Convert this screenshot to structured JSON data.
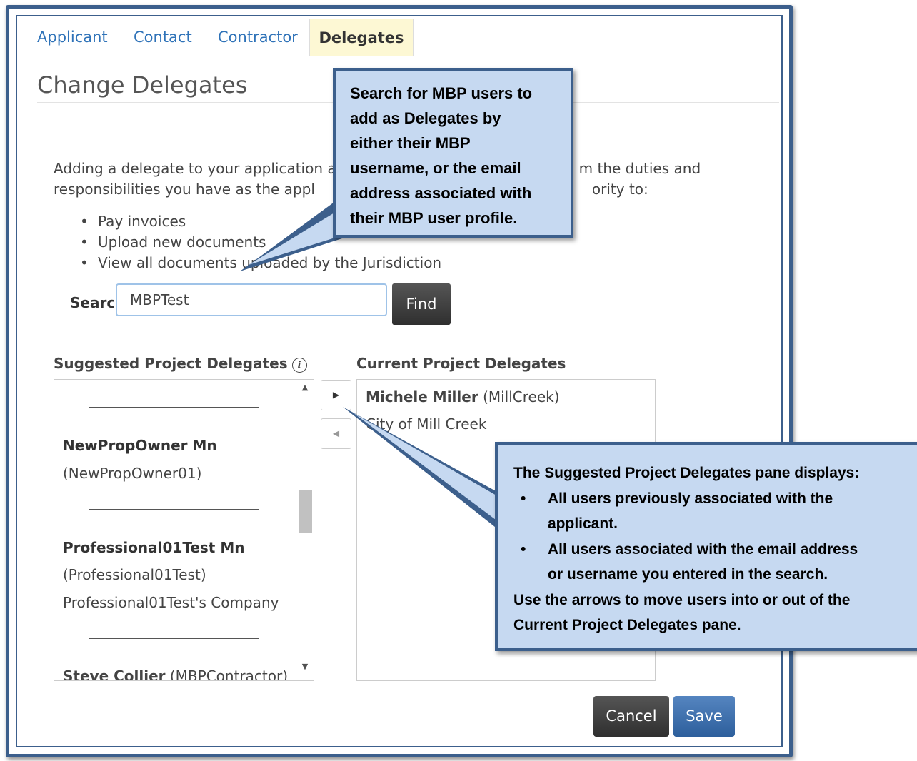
{
  "tabs": [
    {
      "label": "Applicant",
      "active": false
    },
    {
      "label": "Contact",
      "active": false
    },
    {
      "label": "Contractor",
      "active": false
    },
    {
      "label": "Delegates",
      "active": true
    }
  ],
  "page_title": "Change Delegates",
  "intro": {
    "line1_start": "Adding a delegate to your application a",
    "line1_end": "m the duties and",
    "line2_start": "responsibilities you have as the appl",
    "line2_end": "ority to:"
  },
  "bullets": [
    "Pay invoices",
    "Upload new documents",
    "View all documents uploaded by the Jurisdiction"
  ],
  "search": {
    "label": "Search",
    "value": "MBPTest",
    "find_label": "Find"
  },
  "suggested": {
    "title": "Suggested Project Delegates",
    "info_icon": "info-icon",
    "items": [
      {
        "name": "NewPropOwner Mn",
        "username": "(NewPropOwner01)",
        "company": ""
      },
      {
        "name": "Professional01Test Mn",
        "username": "(Professional01Test)",
        "company": "Professional01Test's Company"
      },
      {
        "name": "Steve Collier",
        "username": "(MBPContractor)",
        "company": ""
      }
    ]
  },
  "current": {
    "title": "Current Project Delegates",
    "items": [
      {
        "name": "Michele Miller",
        "username": "(MillCreek)",
        "company": "City of Mill Creek"
      }
    ]
  },
  "move_right_icon": "triangle-right-icon",
  "move_left_icon": "triangle-left-icon",
  "buttons": {
    "cancel": "Cancel",
    "save": "Save"
  },
  "callouts": {
    "search_tip": [
      "Search for MBP users to",
      "add as Delegates by",
      "either their MBP",
      "username, or the email",
      "address associated with",
      "their MBP user profile."
    ],
    "pane_tip": {
      "intro": "The Suggested Project Delegates pane displays:",
      "bullet1_a": "All users previously associated with the",
      "bullet1_b": "applicant.",
      "bullet2_a": "All users associated with the email address",
      "bullet2_b": "or username you entered in the search.",
      "outro_a": "Use the arrows to move users into or out of the",
      "outro_b": "Current Project Delegates pane."
    }
  },
  "colors": {
    "frame": "#3c5f8c",
    "callout_fill": "#c6d9f1",
    "link": "#2e72b8",
    "active_tab": "#fdf8d4",
    "save": "#3a6ea8"
  }
}
